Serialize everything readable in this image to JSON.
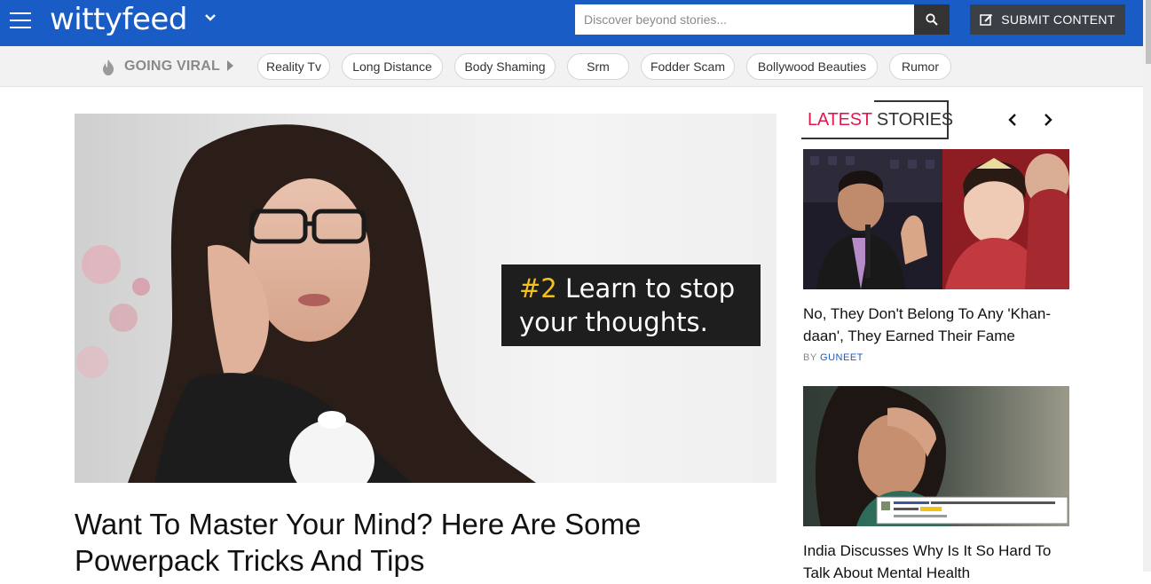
{
  "header": {
    "logo": "wittyfeed",
    "search_placeholder": "Discover beyond stories...",
    "submit_label": "SUBMIT CONTENT"
  },
  "trending": {
    "label": "GOING VIRAL",
    "tags": [
      "Reality Tv",
      "Long Distance",
      "Body Shaming",
      "Srm",
      "Fodder Scam",
      "Bollywood Beauties",
      "Rumor"
    ]
  },
  "article": {
    "image_caption_num": "#2",
    "image_caption_text": "Learn to stop your thoughts.",
    "title": "Want To Master Your Mind? Here Are Some Powerpack Tricks And Tips"
  },
  "sidebar": {
    "heading_accent": "LATEST",
    "heading_rest": "STORIES",
    "stories": [
      {
        "title": "No, They Don't Belong To Any 'Khan-daan', They Earned Their Fame",
        "by": "BY",
        "author": "GUNEET"
      },
      {
        "title": "India Discusses Why Is It So Hard To Talk About Mental Health"
      }
    ]
  },
  "colors": {
    "header_bg": "#1a5cc6",
    "accent_red": "#e1174e",
    "caption_yellow": "#f2c21b"
  },
  "icons": [
    "hamburger-icon",
    "chevron-down-icon",
    "search-icon",
    "edit-icon",
    "flame-icon",
    "caret-right-icon",
    "arrow-left-icon",
    "arrow-right-icon"
  ]
}
